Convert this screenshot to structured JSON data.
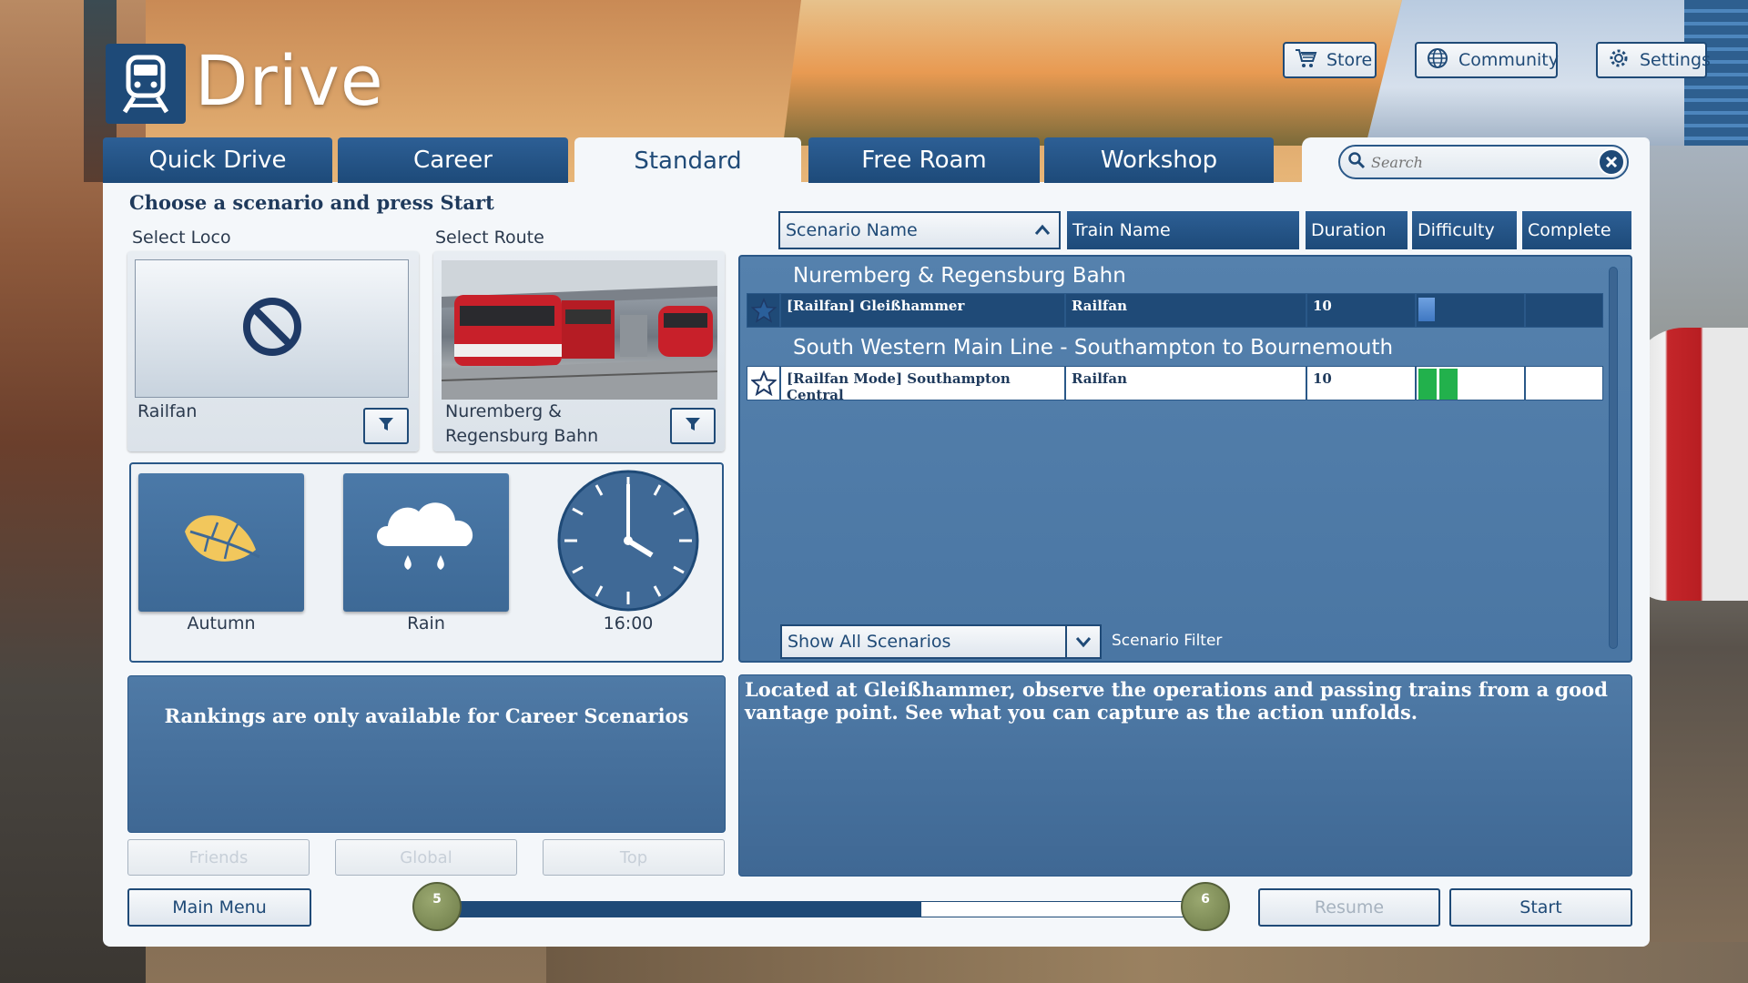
{
  "app": {
    "title": "Drive"
  },
  "header_buttons": [
    {
      "label": "Store",
      "icon": "cart-icon"
    },
    {
      "label": "Community",
      "icon": "globe-icon"
    },
    {
      "label": "Settings",
      "icon": "gear-icon"
    }
  ],
  "tabs": [
    {
      "label": "Quick Drive",
      "active": false
    },
    {
      "label": "Career",
      "active": false
    },
    {
      "label": "Standard",
      "active": true
    },
    {
      "label": "Free Roam",
      "active": false
    },
    {
      "label": "Workshop",
      "active": false
    }
  ],
  "search": {
    "placeholder": "Search",
    "value": ""
  },
  "panel": {
    "title": "Choose a scenario and press Start",
    "select_loco_label": "Select Loco",
    "select_route_label": "Select Route",
    "loco_name": "Railfan",
    "route_name": "Nuremberg & Regensburg Bahn"
  },
  "conditions": {
    "season": "Autumn",
    "weather": "Rain",
    "time": "16:00"
  },
  "rankings": {
    "message": "Rankings are only available for Career Scenarios",
    "buttons": [
      "Friends",
      "Global",
      "Top"
    ]
  },
  "list": {
    "columns": [
      "Scenario Name",
      "Train Name",
      "Duration",
      "Difficulty",
      "Complete"
    ],
    "sorted_column": "Scenario Name",
    "groups": [
      {
        "route": "Nuremberg & Regensburg Bahn",
        "rows": [
          {
            "name": "[Railfan] Gleißhammer",
            "train": "Railfan",
            "duration": "10",
            "difficulty": 1,
            "complete": "",
            "favorite": false,
            "selected": true
          }
        ]
      },
      {
        "route": "South Western Main Line - Southampton to Bournemouth",
        "rows": [
          {
            "name": "[Railfan Mode] Southampton Central",
            "train": "Railfan",
            "duration": "10",
            "difficulty": 2,
            "complete": "",
            "favorite": false,
            "selected": false
          }
        ]
      }
    ],
    "filter_value": "Show All Scenarios",
    "filter_label": "Scenario Filter"
  },
  "description": "Located at Gleißhammer, observe the operations and passing trains from a good vantage point. See what you can capture as the action unfolds.",
  "bottom": {
    "main_menu": "Main Menu",
    "resume": "Resume",
    "start": "Start",
    "level_current": "5",
    "level_next": "6",
    "level_progress": 0.63
  },
  "colors": {
    "primary": "#1f4a77",
    "panel_bg": "#f4f7fa",
    "list_bg": "#4f7aa6",
    "difficulty_blue": "#3f78c2",
    "difficulty_green": "#22b14c",
    "leaf_yellow": "#f2c75c"
  }
}
